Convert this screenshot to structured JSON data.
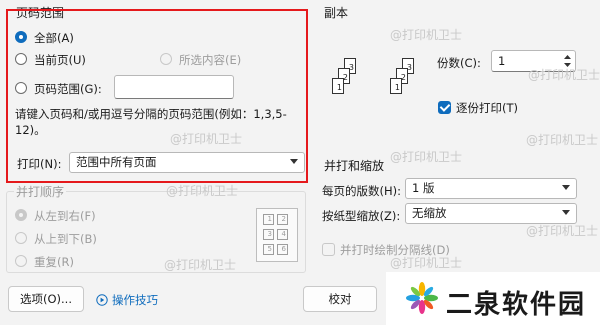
{
  "page_range": {
    "title": "页码范围",
    "all": "全部(A)",
    "current": "当前页(U)",
    "selection": "所选内容(E)",
    "range": "页码范围(G):",
    "range_value": "",
    "hint": "请键入页码和/或用逗号分隔的页码范围(例如：1,3,5-12)。",
    "print_label": "打印(N):",
    "print_value": "范围中所有页面"
  },
  "collate_order": {
    "title": "并打顺序",
    "ltr": "从左到右(F)",
    "ttb": "从上到下(B)",
    "repeat": "重复(R)",
    "grid": [
      "1",
      "2",
      "3",
      "4",
      "5",
      "6"
    ]
  },
  "copies": {
    "title": "副本",
    "count_label": "份数(C):",
    "count_value": "1",
    "collate_label": "逐份打印(T)",
    "collate_checked": true
  },
  "zoom": {
    "title": "并打和缩放",
    "pages_per_sheet_label": "每页的版数(H):",
    "pages_per_sheet_value": "1 版",
    "scale_label": "按纸型缩放(Z):",
    "scale_value": "无缩放",
    "draw_borders_label": "并打时绘制分隔线(D)"
  },
  "footer": {
    "options_button": "选项(O)...",
    "tips_link": "操作技巧",
    "proofread_button": "校对"
  },
  "watermark": {
    "text": "@打印机卫士",
    "brand": "二泉软件园"
  },
  "colors": {
    "accent": "#0f6cbd",
    "highlight": "#e5191c"
  }
}
